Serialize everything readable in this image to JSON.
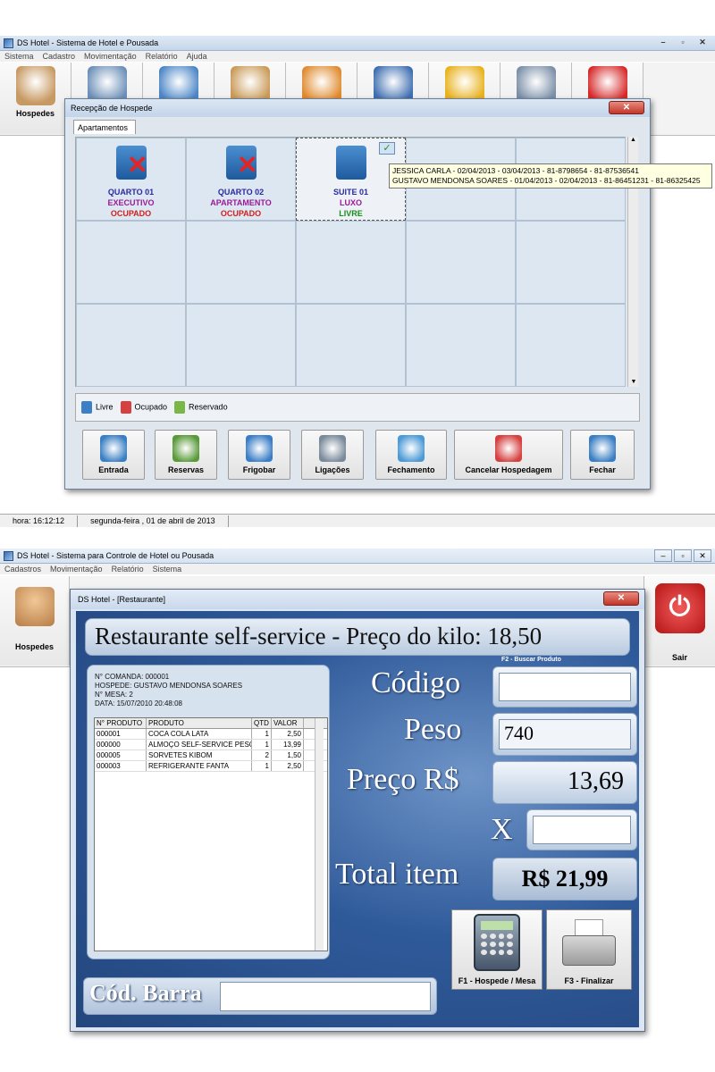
{
  "top": {
    "window_title": "DS Hotel - Sistema de Hotel e Pousada",
    "win_controls": [
      "–",
      "▫",
      "✕"
    ],
    "menu": [
      "Sistema",
      "Cadastro",
      "Movimentação",
      "Relatório",
      "Ajuda"
    ],
    "toolbar": [
      {
        "label": "Hospedes",
        "icon": "guests-icon",
        "color": "#c89a63"
      },
      {
        "label": "",
        "icon": "building-icon",
        "color": "#6c8fb8"
      },
      {
        "label": "",
        "icon": "list-person-icon",
        "color": "#4c86c6"
      },
      {
        "label": "",
        "icon": "group-icon",
        "color": "#c99a58"
      },
      {
        "label": "",
        "icon": "house-icon",
        "color": "#e08a2e"
      },
      {
        "label": "",
        "icon": "staff-icon",
        "color": "#3f6fb0"
      },
      {
        "label": "",
        "icon": "dollar-icon",
        "color": "#e8b21d"
      },
      {
        "label": "",
        "icon": "tools-icon",
        "color": "#7b8fa8"
      },
      {
        "label": "",
        "icon": "power-icon",
        "color": "#d62a2a"
      }
    ],
    "dialog": {
      "title": "Recepção de Hospede",
      "close": "✕",
      "tab": "Apartamentos",
      "rooms": [
        {
          "name": "QUARTO 01",
          "type": "EXECUTIVO",
          "status": "OCUPADO"
        },
        {
          "name": "QUARTO 02",
          "type": "APARTAMENTO",
          "status": "OCUPADO"
        },
        {
          "name": "SUITE 01",
          "type": "LUXO",
          "status": "LIVRE"
        }
      ],
      "tooltip": [
        "JESSICA CARLA - 02/04/2013 - 03/04/2013 - 81-8798654 - 81-87536541",
        "GUSTAVO MENDONSA SOARES - 01/04/2013 - 02/04/2013 - 81-86451231 - 81-86325425"
      ],
      "legend": [
        "Livre",
        "Ocupado",
        "Reservado"
      ],
      "buttons": [
        "Entrada",
        "Reservas",
        "Frigobar",
        "Ligações",
        "Fechamento",
        "Cancelar Hospedagem",
        "Fechar"
      ]
    },
    "status": {
      "hora": "hora:  16:12:12",
      "date": "segunda-feira ,  01 de abril de 2013"
    }
  },
  "bottom": {
    "window_title": "DS Hotel - Sistema para Controle de Hotel ou Pousada",
    "menu": [
      "Cadastros",
      "Movimentação",
      "Relatório",
      "Sistema"
    ],
    "toolbar_left": "Hospedes",
    "toolbar_right": "Sair",
    "rest": {
      "title": "DS Hotel - [Restaurante]",
      "close": "✕",
      "banner": "Restaurante self-service - Preço do kilo: 18,50",
      "info": {
        "comanda": "N° COMANDA:   000001",
        "hospede": "HOSPEDE:      GUSTAVO MENDONSA SOARES",
        "mesa": "N° MESA:        2",
        "data": "DATA:           15/07/2010 20:48:08"
      },
      "columns": [
        "N° PRODUTO",
        "PRODUTO",
        "QTD",
        "VALOR"
      ],
      "rows": [
        [
          "000001",
          "COCA COLA LATA",
          "1",
          "2,50"
        ],
        [
          "000000",
          "ALMOÇO SELF-SERVICE PESO",
          "1",
          "13,99"
        ],
        [
          "000005",
          "SORVETES KIBOM",
          "2",
          "1,50"
        ],
        [
          "000003",
          "REFRIGERANTE FANTA",
          "1",
          "2,50"
        ]
      ],
      "buscar": "F2 - Buscar Produto",
      "codigo_label": "Código",
      "codigo_value": "",
      "peso_label": "Peso",
      "peso_value": "740",
      "preco_label": "Preço R$",
      "preco_value": "13,69",
      "x_label": "X",
      "x_value": "",
      "total_label": "Total item",
      "total_value": "R$ 21,99",
      "barra_label": "Cód. Barra",
      "barra_value": "",
      "f1": "F1 - Hospede / Mesa",
      "f3": "F3 - Finalizar"
    }
  }
}
